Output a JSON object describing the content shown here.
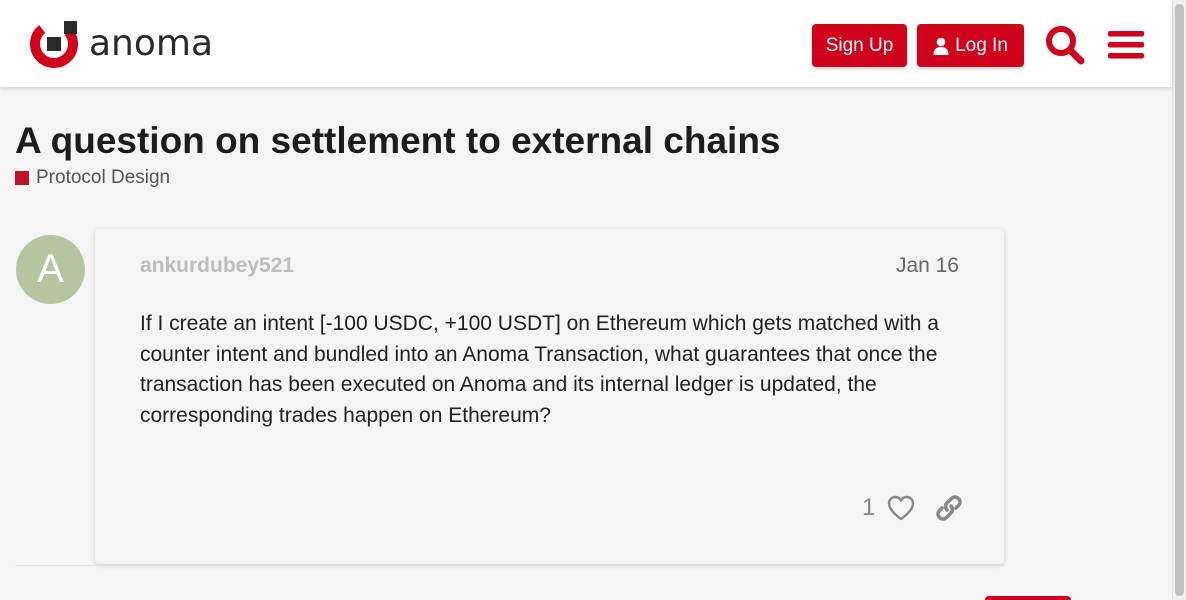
{
  "header": {
    "logo_text": "anoma",
    "signup_label": "Sign Up",
    "login_label": "Log In",
    "brand_color": "#d0021b",
    "search_icon": "search-icon",
    "menu_icon": "hamburger-menu-icon"
  },
  "topic": {
    "title": "A question on settlement to external chains",
    "category": "Protocol Design",
    "category_color": "#c2102a"
  },
  "post": {
    "avatar_letter": "A",
    "avatar_color": "#b5c4a1",
    "username": "ankurdubey521",
    "date": "Jan 16",
    "body": "If I create an intent [-100 USDC, +100 USDT] on Ethereum which gets matched with a counter intent and bundled into an Anoma Transaction, what guarantees that once the transaction has been executed on Anoma and its internal ledger is updated, the corresponding trades happen on Ethereum?",
    "like_count": "1",
    "like_icon": "heart-icon",
    "link_icon": "link-icon"
  }
}
